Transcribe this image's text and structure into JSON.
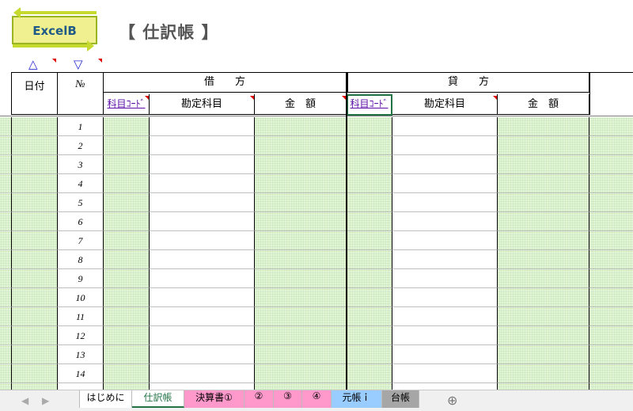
{
  "logo": {
    "text": "ExcelB"
  },
  "title": "【 仕訳帳 】",
  "sort": {
    "asc": "△",
    "desc": "▽"
  },
  "header": {
    "date": "日付",
    "no": "№",
    "debit": "借　　方",
    "credit": "貸　　方",
    "code": "科目ｺｰﾄﾞ",
    "account": "勘定科目",
    "amount": "金　額"
  },
  "rows": [
    "1",
    "2",
    "3",
    "4",
    "5",
    "6",
    "7",
    "8",
    "9",
    "10",
    "11",
    "12",
    "13",
    "14"
  ],
  "tabs": {
    "nav_prev": "◀",
    "nav_next": "▶",
    "items": [
      {
        "label": "はじめに",
        "bg": "#ffffff",
        "color": "#000000"
      },
      {
        "label": "仕訳帳",
        "bg": "#ffffff",
        "color": "#217346"
      },
      {
        "label": "決算書①",
        "bg": "#ff99cc",
        "color": "#000000"
      },
      {
        "label": "②",
        "bg": "#ff99cc",
        "color": "#000000"
      },
      {
        "label": "③",
        "bg": "#ff99cc",
        "color": "#000000"
      },
      {
        "label": "④",
        "bg": "#ff99cc",
        "color": "#000000"
      },
      {
        "label": "元帳ｉ",
        "bg": "#99ccff",
        "color": "#000000"
      },
      {
        "label": "台帳",
        "bg": "#a6a6a6",
        "color": "#000000"
      }
    ],
    "add": "⊕"
  }
}
